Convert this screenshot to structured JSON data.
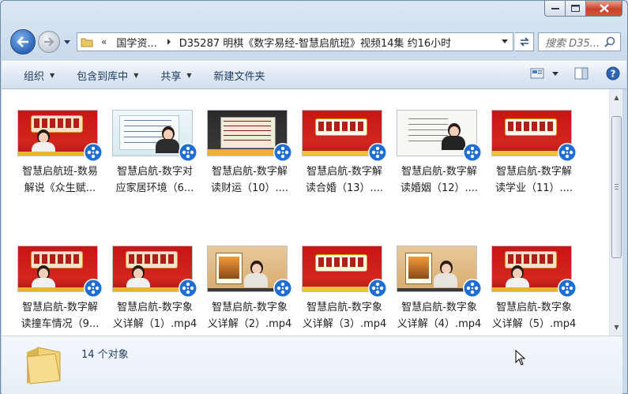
{
  "window": {
    "caption_buttons": [
      "minimize-icon",
      "maximize-icon",
      "close-icon"
    ]
  },
  "nav": {
    "breadcrumb_overflow": "«",
    "breadcrumbs": [
      "国学资...",
      "D35287 明棋《数字易经-智慧启航班》视频14集 约16小时"
    ],
    "search_placeholder": "搜索 D35..."
  },
  "toolbar": {
    "organize": "组织",
    "include_in_library": "包含到库中",
    "share": "共享",
    "new_folder": "新建文件夹"
  },
  "files": [
    {
      "line1": "智慧启航班-数易",
      "line2": "解说《众生赋...",
      "thumb": "red"
    },
    {
      "line1": "智慧启航-数字对",
      "line2": "应家居环境（6...",
      "thumb": "slide"
    },
    {
      "line1": "智慧启航-数字解",
      "line2": "读财运（10）....",
      "thumb": "dark"
    },
    {
      "line1": "智慧启航-数字解",
      "line2": "读合婚（13）....",
      "thumb": "red-banner"
    },
    {
      "line1": "智慧启航-数字解",
      "line2": "读婚姻（12）....",
      "thumb": "white"
    },
    {
      "line1": "智慧启航-数字解",
      "line2": "读学业（11）....",
      "thumb": "red-banner"
    },
    {
      "line1": "智慧启航-数字解",
      "line2": "读撞车情况（9...",
      "thumb": "red"
    },
    {
      "line1": "智慧启航-数字象",
      "line2": "义详解（1）.mp4",
      "thumb": "red"
    },
    {
      "line1": "智慧启航-数字象",
      "line2": "义详解（2）.mp4",
      "thumb": "wood"
    },
    {
      "line1": "智慧启航-数字象",
      "line2": "义详解（3）.mp4",
      "thumb": "red-banner"
    },
    {
      "line1": "智慧启航-数字象",
      "line2": "义详解（4）.mp4",
      "thumb": "wood"
    },
    {
      "line1": "智慧启航-数字象",
      "line2": "义详解（5）.mp4",
      "thumb": "red"
    }
  ],
  "status": {
    "count": "14 个对象"
  },
  "colors": {
    "accent": "#1e3a5f",
    "video_badge": "#1f6ed4"
  }
}
